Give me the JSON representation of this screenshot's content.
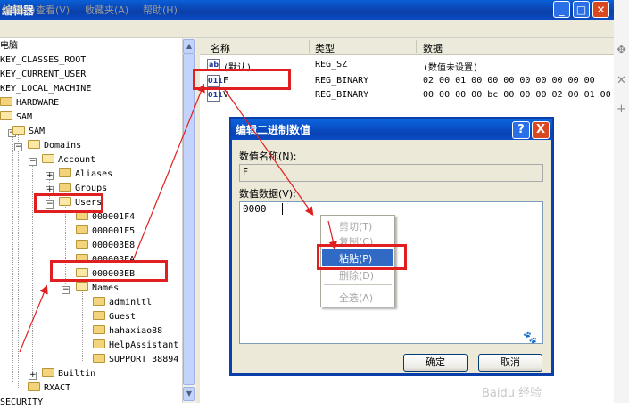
{
  "window": {
    "title": "编辑器",
    "menu": [
      "编辑(E)",
      "查看(V)",
      "收藏夹(A)",
      "帮助(H)"
    ]
  },
  "tree": {
    "computer": "电脑",
    "hkcr": "KEY_CLASSES_ROOT",
    "hkcu": "KEY_CURRENT_USER",
    "hklm": "KEY_LOCAL_MACHINE",
    "hardware": "HARDWARE",
    "sam": "SAM",
    "sam2": "SAM",
    "domains": "Domains",
    "account": "Account",
    "aliases": "Aliases",
    "groups": "Groups",
    "users": "Users",
    "u1": "000001F4",
    "u2": "000001F5",
    "u3": "000003E8",
    "u4": "000003EA",
    "u5": "000003EB",
    "names": "Names",
    "n1": "adminltl",
    "n2": "Guest",
    "n3": "hahaxiao88",
    "n4": "HelpAssistant",
    "n5": "SUPPORT_38894",
    "builtin": "Builtin",
    "rxact": "RXACT",
    "security": "SECURITY"
  },
  "list": {
    "col_name": "名称",
    "col_type": "类型",
    "col_data": "数据",
    "rows": [
      {
        "icon": "ab",
        "name": "(默认)",
        "type": "REG_SZ",
        "data": "(数值未设置)"
      },
      {
        "icon": "011",
        "name": "F",
        "type": "REG_BINARY",
        "data": "02 00 01 00 00 00 00 00 00 00 00"
      },
      {
        "icon": "011",
        "name": "V",
        "type": "REG_BINARY",
        "data": "00 00 00 00 bc 00 00 00 02 00 01 00"
      }
    ]
  },
  "dialog": {
    "title": "编辑二进制数值",
    "help_label": "?",
    "close_label": "X",
    "name_label": "数值名称(N):",
    "name_value": "F",
    "data_label": "数值数据(V):",
    "data_value": "0000",
    "ok_label": "确定",
    "cancel_label": "取消"
  },
  "context_menu": {
    "cut": "剪切(T)",
    "copy": "复制(C)",
    "paste": "粘贴(P)",
    "delete": "删除(D)",
    "select_all": "全选(A)"
  },
  "watermark": "Baidu 经验"
}
